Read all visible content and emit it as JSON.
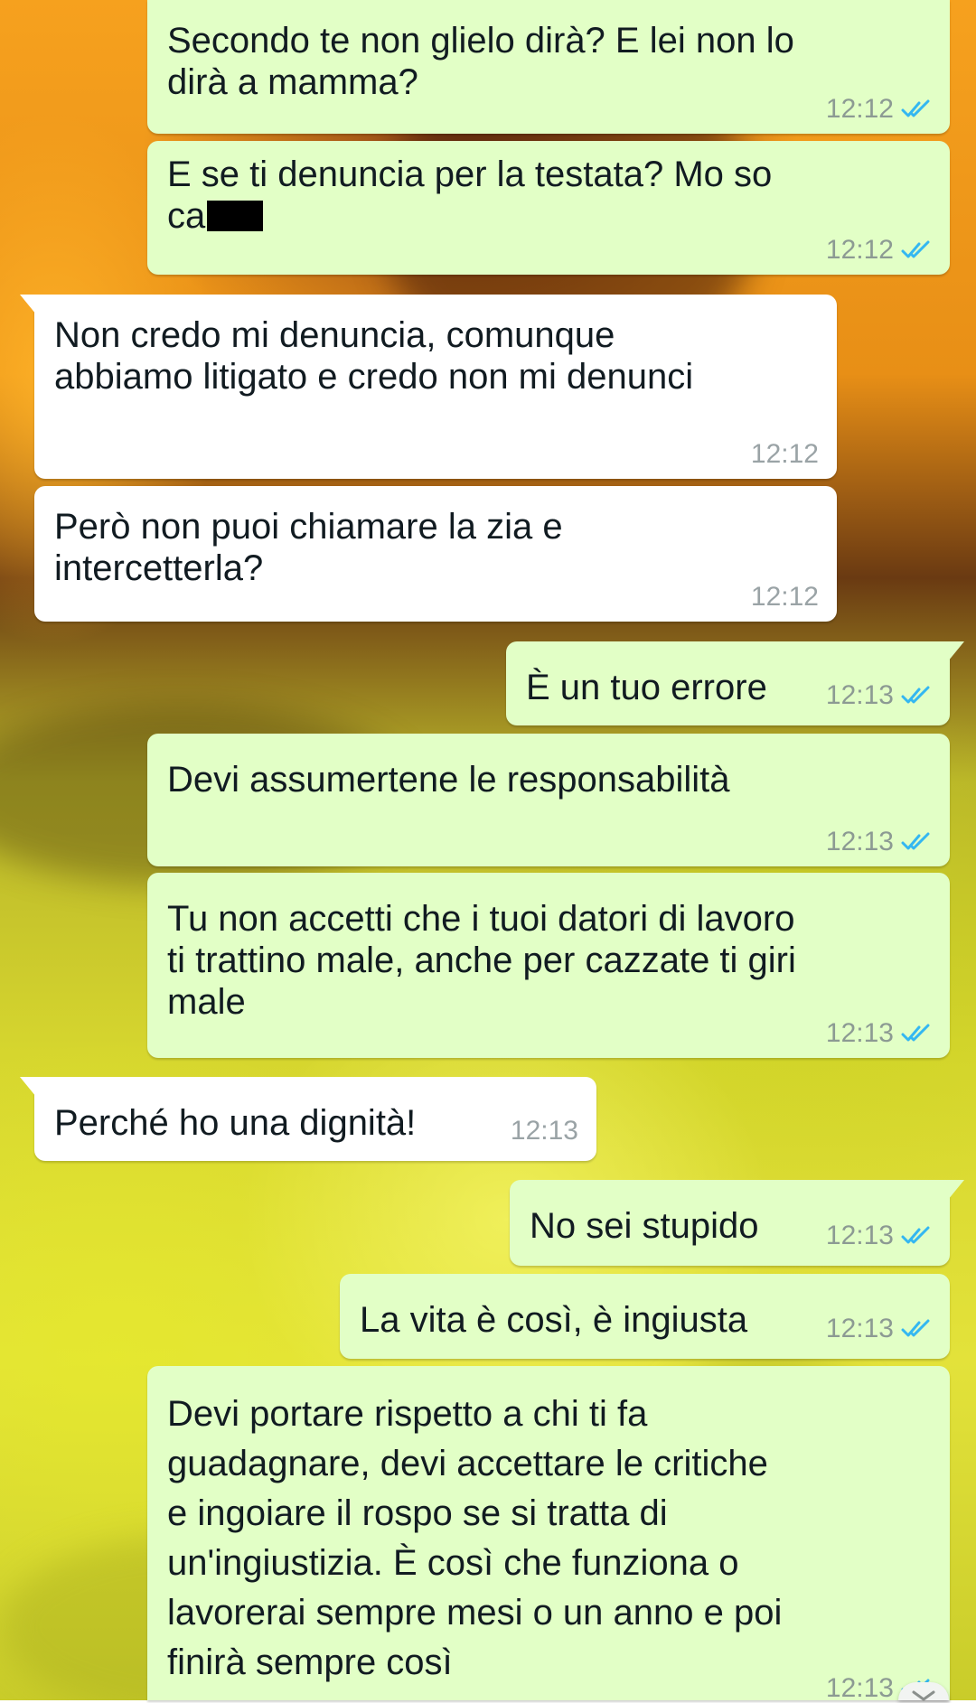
{
  "messages": [
    {
      "id": 1,
      "direction": "outgoing",
      "text": "Secondo te non glielo dirà? E lei non lo\ndirà a mamma?",
      "time": "12:12",
      "status": "read"
    },
    {
      "id": 2,
      "direction": "outgoing",
      "text_before": "E se ti denuncia per la testata? Mo so\nca",
      "redacted": true,
      "time": "12:12",
      "status": "read"
    },
    {
      "id": 3,
      "direction": "incoming",
      "text": "Non credo mi denuncia, comunque\nabbiamo litigato e credo non mi denunci",
      "time": "12:12"
    },
    {
      "id": 4,
      "direction": "incoming",
      "text": "Però non puoi chiamare la zia e\nintercetterla?",
      "time": "12:12"
    },
    {
      "id": 5,
      "direction": "outgoing",
      "text": "È un tuo errore",
      "time": "12:13",
      "status": "read"
    },
    {
      "id": 6,
      "direction": "outgoing",
      "text": "Devi assumertene le responsabilità",
      "time": "12:13",
      "status": "read"
    },
    {
      "id": 7,
      "direction": "outgoing",
      "text": "Tu non accetti che i tuoi datori di lavoro\nti trattino male, anche per cazzate ti giri\nmale",
      "time": "12:13",
      "status": "read"
    },
    {
      "id": 8,
      "direction": "incoming",
      "text": "Perché ho una dignità!",
      "time": "12:13"
    },
    {
      "id": 9,
      "direction": "outgoing",
      "text": "No sei stupido",
      "time": "12:13",
      "status": "read"
    },
    {
      "id": 10,
      "direction": "outgoing",
      "text": "La vita è così, è ingiusta",
      "time": "12:13",
      "status": "read"
    },
    {
      "id": 11,
      "direction": "outgoing",
      "text": "Devi portare rispetto a chi ti fa\nguadagnare, devi accettare le critiche\ne ingoiare il rospo se si tratta di\nun'ingiustizia. È così che funziona o\nlavorerai sempre mesi o un anno e poi\nfinirà sempre così",
      "time": "12:13",
      "status": "read"
    }
  ],
  "colors": {
    "outgoing_bubble": "#e2ffc6",
    "incoming_bubble": "#ffffff",
    "read_tick": "#34b7f1",
    "timestamp": "#8c9a93"
  },
  "icons": {
    "read_receipt": "double-check-icon",
    "scroll_down": "chevron-down-icon"
  }
}
